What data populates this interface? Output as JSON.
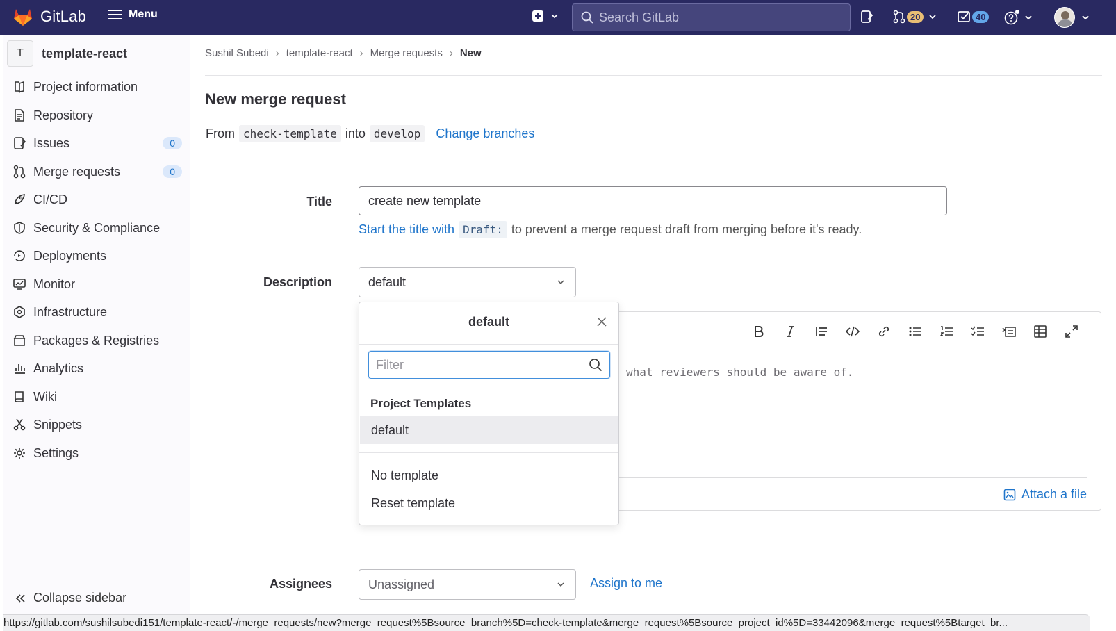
{
  "topbar": {
    "brand": "GitLab",
    "menu_label": "Menu",
    "search_placeholder": "Search GitLab",
    "merge_requests_count": "20",
    "todos_count": "40",
    "colors": {
      "bg": "#292961",
      "mr_badge": "#e9be74",
      "todo_badge": "#63a6e9"
    }
  },
  "sidebar": {
    "project_initial": "T",
    "project_name": "template-react",
    "items": [
      {
        "label": "Project information",
        "icon": "project-icon"
      },
      {
        "label": "Repository",
        "icon": "document-icon"
      },
      {
        "label": "Issues",
        "icon": "issues-icon",
        "count": "0"
      },
      {
        "label": "Merge requests",
        "icon": "merge-request-icon",
        "count": "0"
      },
      {
        "label": "CI/CD",
        "icon": "rocket-icon"
      },
      {
        "label": "Security & Compliance",
        "icon": "shield-icon"
      },
      {
        "label": "Deployments",
        "icon": "deployments-icon"
      },
      {
        "label": "Monitor",
        "icon": "monitor-icon"
      },
      {
        "label": "Infrastructure",
        "icon": "cloud-gear-icon"
      },
      {
        "label": "Packages & Registries",
        "icon": "package-icon"
      },
      {
        "label": "Analytics",
        "icon": "chart-icon"
      },
      {
        "label": "Wiki",
        "icon": "book-icon"
      },
      {
        "label": "Snippets",
        "icon": "scissors-icon"
      },
      {
        "label": "Settings",
        "icon": "gear-icon"
      }
    ],
    "collapse_label": "Collapse sidebar"
  },
  "breadcrumb": [
    "Sushil Subedi",
    "template-react",
    "Merge requests",
    "New"
  ],
  "page": {
    "title": "New merge request",
    "from_label": "From",
    "source_branch": "check-template",
    "into_label": "into",
    "target_branch": "develop",
    "change_branches": "Change branches"
  },
  "form": {
    "title_label": "Title",
    "title_value": "create new template",
    "hint_link": "Start the title with",
    "hint_code": "Draft:",
    "hint_rest": "to prevent a merge request draft from merging before it's ready.",
    "description_label": "Description",
    "template_selected": "default",
    "editor_placeholder": "what reviewers should be aware of.",
    "attach_label": "Attach a file",
    "assignees_label": "Assignees",
    "assignees_value": "Unassigned",
    "assign_to_me": "Assign to me"
  },
  "dropdown": {
    "title": "default",
    "filter_placeholder": "Filter",
    "section_heading": "Project Templates",
    "templates": [
      "default"
    ],
    "actions": [
      "No template",
      "Reset template"
    ]
  },
  "status_url": "https://gitlab.com/sushilsubedi151/template-react/-/merge_requests/new?merge_request%5Bsource_branch%5D=check-template&merge_request%5Bsource_project_id%5D=33442096&merge_request%5Btarget_br..."
}
